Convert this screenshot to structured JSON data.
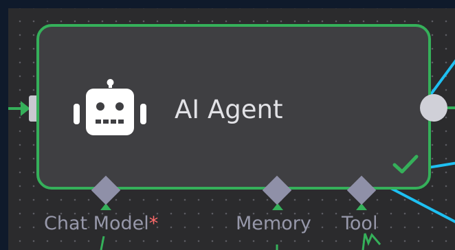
{
  "node": {
    "title": "AI Agent",
    "icon": "robot-icon",
    "status": "success",
    "status_icon": "checkmark-icon"
  },
  "ports": {
    "chat_model": {
      "label": "Chat Model",
      "required_marker": "*"
    },
    "memory": {
      "label": "Memory"
    },
    "tool": {
      "label": "Tool"
    }
  },
  "colors": {
    "canvas_bg": "#2b2b2d",
    "node_bg": "#3f3f42",
    "node_border_success": "#35b05a",
    "connection_line": "#1ec0f2",
    "port_diamond": "#8f90a8",
    "required_marker": "#ff6b6b"
  }
}
